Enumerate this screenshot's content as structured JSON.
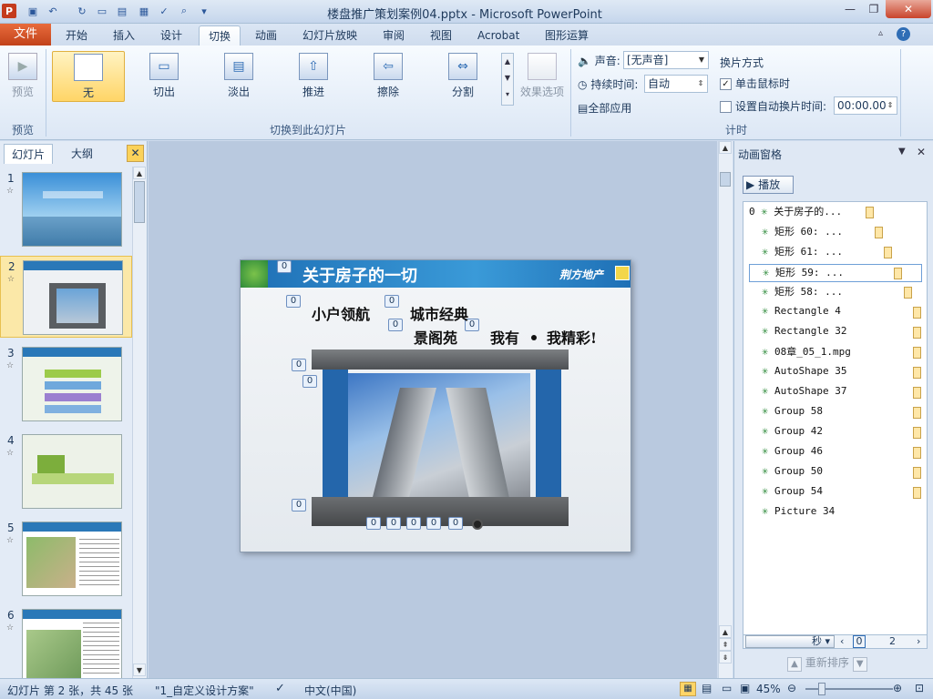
{
  "window": {
    "title": "楼盘推广策划案例04.pptx - Microsoft PowerPoint"
  },
  "tabs": [
    "文件",
    "开始",
    "插入",
    "设计",
    "切换",
    "动画",
    "幻灯片放映",
    "审阅",
    "视图",
    "Acrobat",
    "图形运算"
  ],
  "active_tab": "切换",
  "ribbon": {
    "preview_label": "预览",
    "preview_group": "预览",
    "transitions": [
      "无",
      "切出",
      "淡出",
      "推进",
      "擦除",
      "分割"
    ],
    "effect_options": "效果选项",
    "transition_group": "切换到此幻灯片",
    "sound_label": "声音:",
    "sound_value": "[无声音]",
    "duration_label": "持续时间:",
    "duration_value": "自动",
    "apply_all": "全部应用",
    "advance_title": "换片方式",
    "on_click": "单击鼠标时",
    "auto_after": "设置自动换片时间:",
    "auto_time": "00:00.00",
    "timing_group": "计时"
  },
  "left_panel": {
    "tab_slides": "幻灯片",
    "tab_outline": "大纲",
    "slide_numbers": [
      "1",
      "2",
      "3",
      "4",
      "5",
      "6"
    ]
  },
  "slide": {
    "title": "关于房子的一切",
    "logo": "荆方地产",
    "line1a": "小户领航",
    "line1b": "城市经典",
    "line2a": "景阁苑",
    "line2b": "我有",
    "line2c": "我精彩!",
    "badge": "0"
  },
  "animation_pane": {
    "title": "动画窗格",
    "play": "播放",
    "items": [
      {
        "num": "0",
        "label": "关于房子的..."
      },
      {
        "num": "",
        "label": "矩形 60: ..."
      },
      {
        "num": "",
        "label": "矩形 61: ..."
      },
      {
        "num": "",
        "label": "矩形 59: ..."
      },
      {
        "num": "",
        "label": "矩形 58: ..."
      },
      {
        "num": "",
        "label": "Rectangle 4"
      },
      {
        "num": "",
        "label": "Rectangle 32"
      },
      {
        "num": "",
        "label": "08章_05_1.mpg"
      },
      {
        "num": "",
        "label": "AutoShape 35"
      },
      {
        "num": "",
        "label": "AutoShape 37"
      },
      {
        "num": "",
        "label": "Group 58"
      },
      {
        "num": "",
        "label": "Group 42"
      },
      {
        "num": "",
        "label": "Group 46"
      },
      {
        "num": "",
        "label": "Group 50"
      },
      {
        "num": "",
        "label": "Group 54"
      },
      {
        "num": "",
        "label": "Picture 34"
      }
    ],
    "seconds_label": "秒",
    "scale_start": "0",
    "scale_end": "2",
    "reorder": "重新排序"
  },
  "status": {
    "slide_info": "幻灯片 第 2 张，共 45 张",
    "theme": "\"1_自定义设计方案\"",
    "language": "中文(中国)",
    "zoom": "45%"
  }
}
